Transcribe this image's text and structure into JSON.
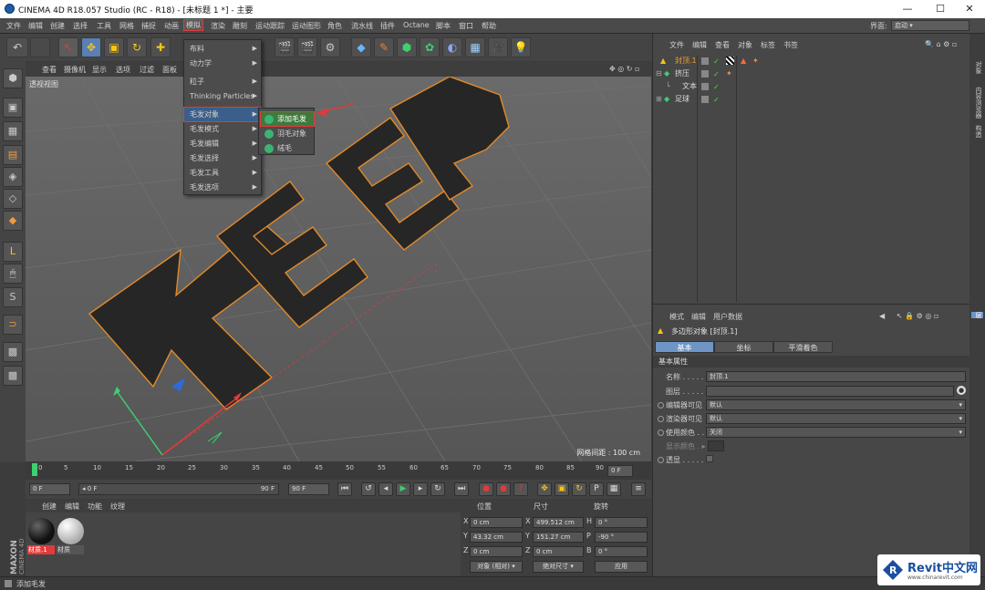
{
  "window": {
    "title": "CINEMA 4D R18.057 Studio (RC - R18) - [未标题 1 *] - 主要",
    "minimize": "—",
    "maximize": "☐",
    "close": "✕"
  },
  "menubar": {
    "items": [
      "文件",
      "编辑",
      "创建",
      "选择",
      "工具",
      "网格",
      "捕捉",
      "动画",
      "模拟",
      "渲染",
      "雕刻",
      "运动跟踪",
      "运动图形",
      "角色",
      "流水线",
      "插件",
      "Octane",
      "脚本",
      "窗口",
      "帮助"
    ],
    "active": "模拟",
    "layout_label": "界面:",
    "layout_value": "启动"
  },
  "viewport": {
    "menu": [
      "查看",
      "摄像机",
      "显示",
      "选项",
      "过滤",
      "面板"
    ],
    "label": "透视视图",
    "grid_spacing": "网格间距 : 100 cm",
    "text_3d": "KEEP"
  },
  "dropdown": {
    "items": [
      "布料",
      "动力学",
      "粒子",
      "Thinking Particles",
      "毛发对象",
      "毛发模式",
      "毛发编辑",
      "毛发选择",
      "毛发工具",
      "毛发选项"
    ],
    "highlighted": "毛发对象"
  },
  "submenu": {
    "items": [
      "添加毛发",
      "羽毛对象",
      "绒毛"
    ],
    "highlighted": "添加毛发"
  },
  "timeline": {
    "ticks": [
      "0",
      "5",
      "10",
      "15",
      "20",
      "25",
      "30",
      "35",
      "40",
      "45",
      "50",
      "55",
      "60",
      "65",
      "70",
      "75",
      "80",
      "85",
      "90"
    ],
    "end_field": "0 F"
  },
  "transport": {
    "start": "0 F",
    "slider": "0 F",
    "end_slider": "90 F",
    "end": "90 F"
  },
  "materials": {
    "menu": [
      "创建",
      "编辑",
      "功能",
      "纹理"
    ],
    "items": [
      {
        "label": "材质.1",
        "color": "#111111"
      },
      {
        "label": "材质",
        "color": "#e8e8e8"
      }
    ]
  },
  "coords": {
    "headers": [
      "位置",
      "尺寸",
      "旋转"
    ],
    "rows": [
      {
        "axis": "X",
        "pos": "0 cm",
        "saxis": "X",
        "size": "499.512 cm",
        "raxis": "H",
        "rot": "0 °"
      },
      {
        "axis": "Y",
        "pos": "43.32 cm",
        "saxis": "Y",
        "size": "151.27 cm",
        "raxis": "P",
        "rot": "-90 °"
      },
      {
        "axis": "Z",
        "pos": "0 cm",
        "saxis": "Z",
        "size": "0 cm",
        "raxis": "B",
        "rot": "0 °"
      }
    ],
    "mode": "对象 (相对)",
    "size_mode": "绝对尺寸",
    "apply": "应用"
  },
  "objects": {
    "menu": [
      "文件",
      "编辑",
      "查看",
      "对象",
      "标签",
      "书签"
    ],
    "rows": [
      {
        "name": "封顶.1",
        "color": "#f0a030"
      },
      {
        "name": "挤压",
        "color": "#9fd0ff"
      },
      {
        "name": "文本",
        "color": "#dddddd"
      },
      {
        "name": "足球",
        "color": "#9fd0ff"
      }
    ]
  },
  "attributes": {
    "menu": [
      "模式",
      "编辑",
      "用户数据"
    ],
    "title": "多边形对象 [封顶.1]",
    "tabs": [
      "基本",
      "坐标",
      "平滑着色(Phong)"
    ],
    "section": "基本属性",
    "props": [
      {
        "label": "名称 . . . . .",
        "value": "封顶.1"
      },
      {
        "label": "图层 . . . . .",
        "value": ""
      },
      {
        "label": "编辑器可见",
        "value": "默认"
      },
      {
        "label": "渲染器可见",
        "value": "默认"
      },
      {
        "label": "使用颜色 . .",
        "value": "关闭"
      },
      {
        "label": "显示颜色 . ▸",
        "value": ""
      },
      {
        "label": "透显 . . . . . .",
        "value": ""
      }
    ]
  },
  "right_strip": [
    "对象",
    "内容浏览器",
    "构造",
    "层"
  ],
  "status": "添加毛发",
  "watermark": {
    "brand": "Revit中文网",
    "url": "www.chinarevit.com"
  }
}
